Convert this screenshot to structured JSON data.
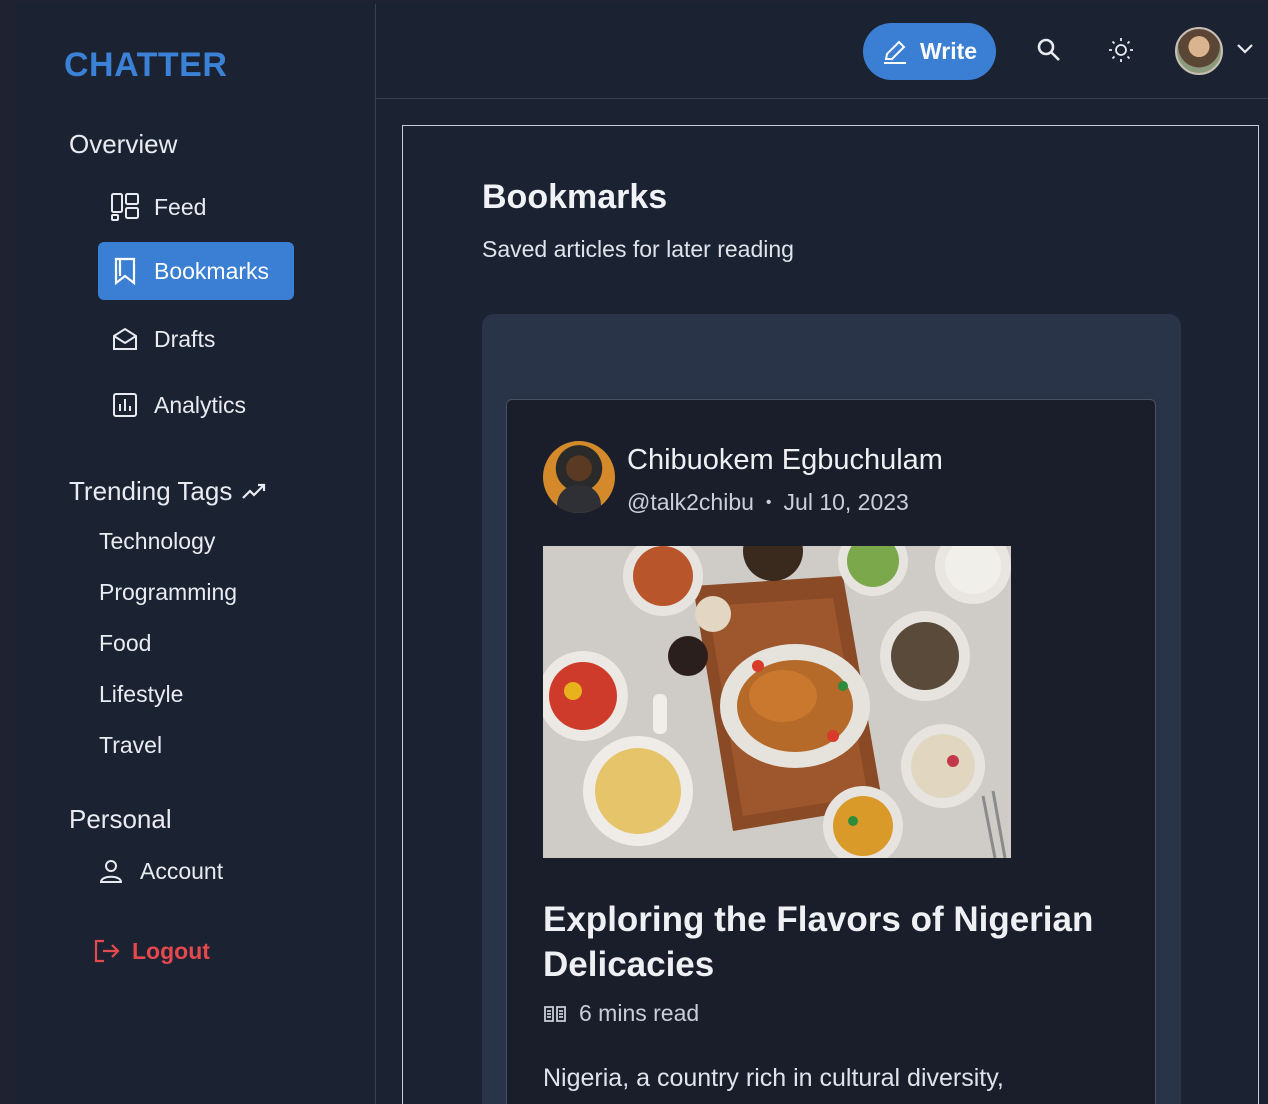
{
  "brand": "CHATTER",
  "sidebar": {
    "overview_title": "Overview",
    "nav": [
      {
        "label": "Feed",
        "icon": "feed-icon",
        "active": false
      },
      {
        "label": "Bookmarks",
        "icon": "bookmark-icon",
        "active": true
      },
      {
        "label": "Drafts",
        "icon": "drafts-icon",
        "active": false
      },
      {
        "label": "Analytics",
        "icon": "analytics-icon",
        "active": false
      }
    ],
    "trending_title": "Trending Tags",
    "tags": [
      "Technology",
      "Programming",
      "Food",
      "Lifestyle",
      "Travel"
    ],
    "personal_title": "Personal",
    "account_label": "Account",
    "logout_label": "Logout"
  },
  "topbar": {
    "write_label": "Write",
    "icons": [
      "search-icon",
      "sun-icon",
      "chevron-down-icon"
    ]
  },
  "page": {
    "title": "Bookmarks",
    "subtitle": "Saved articles for later reading"
  },
  "post": {
    "author_name": "Chibuokem Egbuchulam",
    "handle": "@talk2chibu",
    "date": "Jul 10, 2023",
    "title": "Exploring the Flavors of Nigerian Delicacies",
    "read_time": "6 mins read",
    "excerpt": "Nigeria, a country rich in cultural diversity,"
  },
  "colors": {
    "accent": "#3b7fd4",
    "brand": "#3b82d6",
    "danger": "#e5484d",
    "background": "#1b2232",
    "card": "#1a1e2b",
    "card_wrap": "#2a3448"
  }
}
